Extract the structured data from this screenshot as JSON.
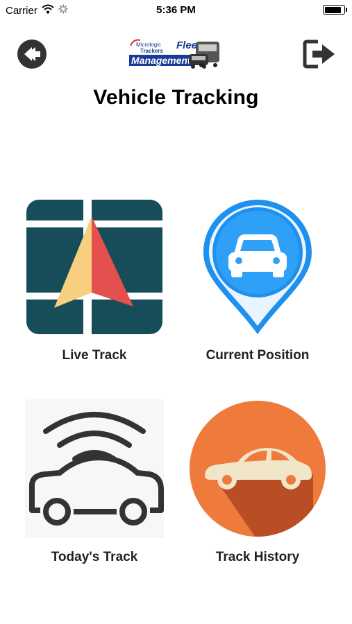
{
  "status_bar": {
    "carrier": "Carrier",
    "time": "5:36 PM",
    "battery_level": 0.95
  },
  "header": {
    "title": "Vehicle Tracking"
  },
  "logo": {
    "line1": "Micrologic",
    "line2": "Trackers",
    "line3": "Fleet",
    "line4": "Management"
  },
  "menu": {
    "live_track": "Live Track",
    "current_position": "Current Position",
    "todays_track": "Today's Track",
    "track_history": "Track History"
  },
  "colors": {
    "live_track_bg": "#174D59",
    "current_position_pin": "#1E90EE",
    "track_history_bg": "#EE7A3C"
  }
}
